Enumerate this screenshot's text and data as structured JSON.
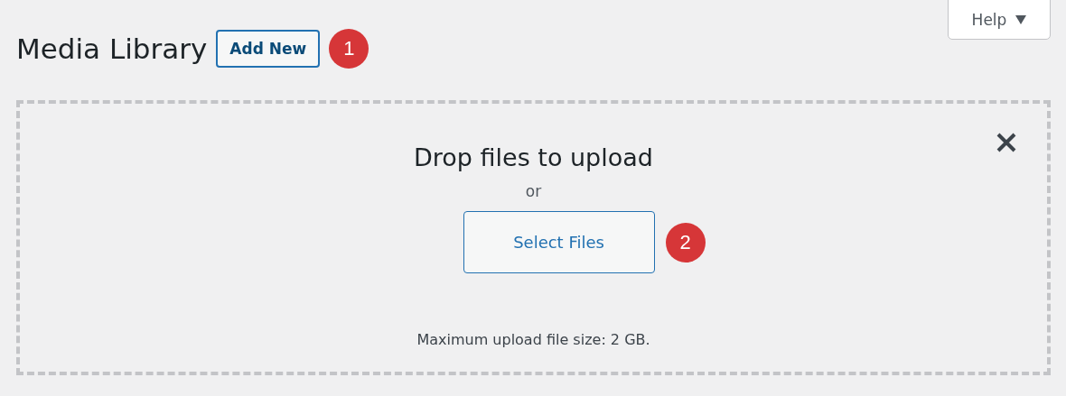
{
  "help_button": {
    "label": "Help"
  },
  "header": {
    "title": "Media Library",
    "add_new_button": "Add New",
    "callout": "1"
  },
  "uploader": {
    "heading": "Drop files to upload",
    "separator": "or",
    "select_button": "Select Files",
    "callout": "2",
    "max_size_note": "Maximum upload file size: 2 GB."
  }
}
